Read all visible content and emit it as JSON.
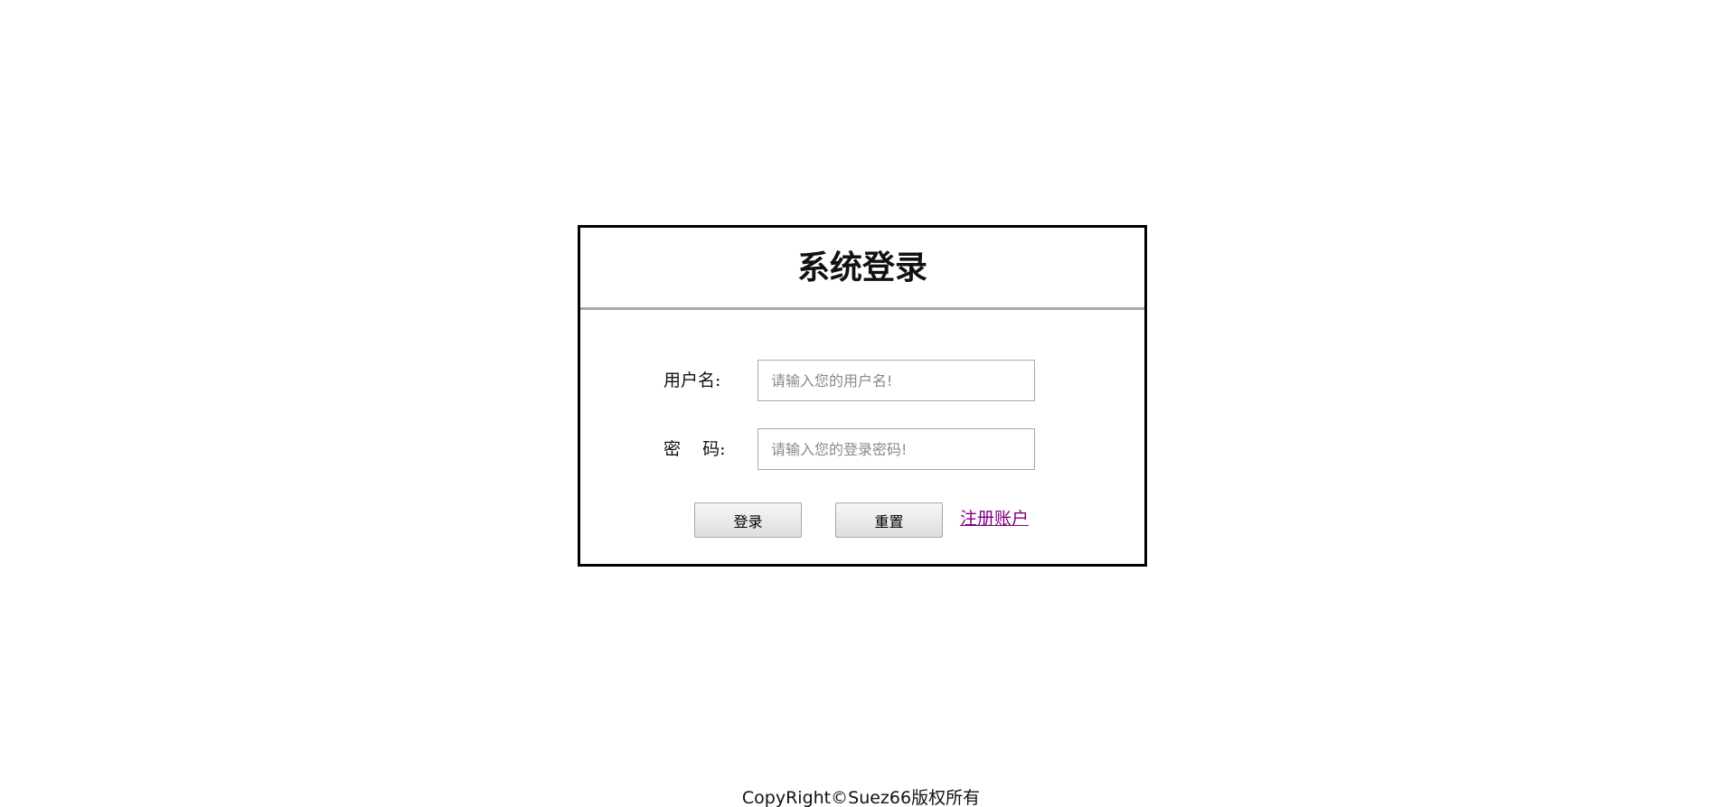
{
  "login": {
    "title": "系统登录",
    "username_label": "用户名:",
    "username_placeholder": "请输入您的用户名!",
    "password_label": "密    码:",
    "password_placeholder": "请输入您的登录密码!",
    "login_button": "登录",
    "reset_button": "重置",
    "register_link": "注册账户"
  },
  "footer": {
    "copyright": "CopyRight©Suez66版权所有"
  },
  "colors": {
    "link": "#800080",
    "border": "#000000",
    "divider": "#a8a8a8"
  }
}
